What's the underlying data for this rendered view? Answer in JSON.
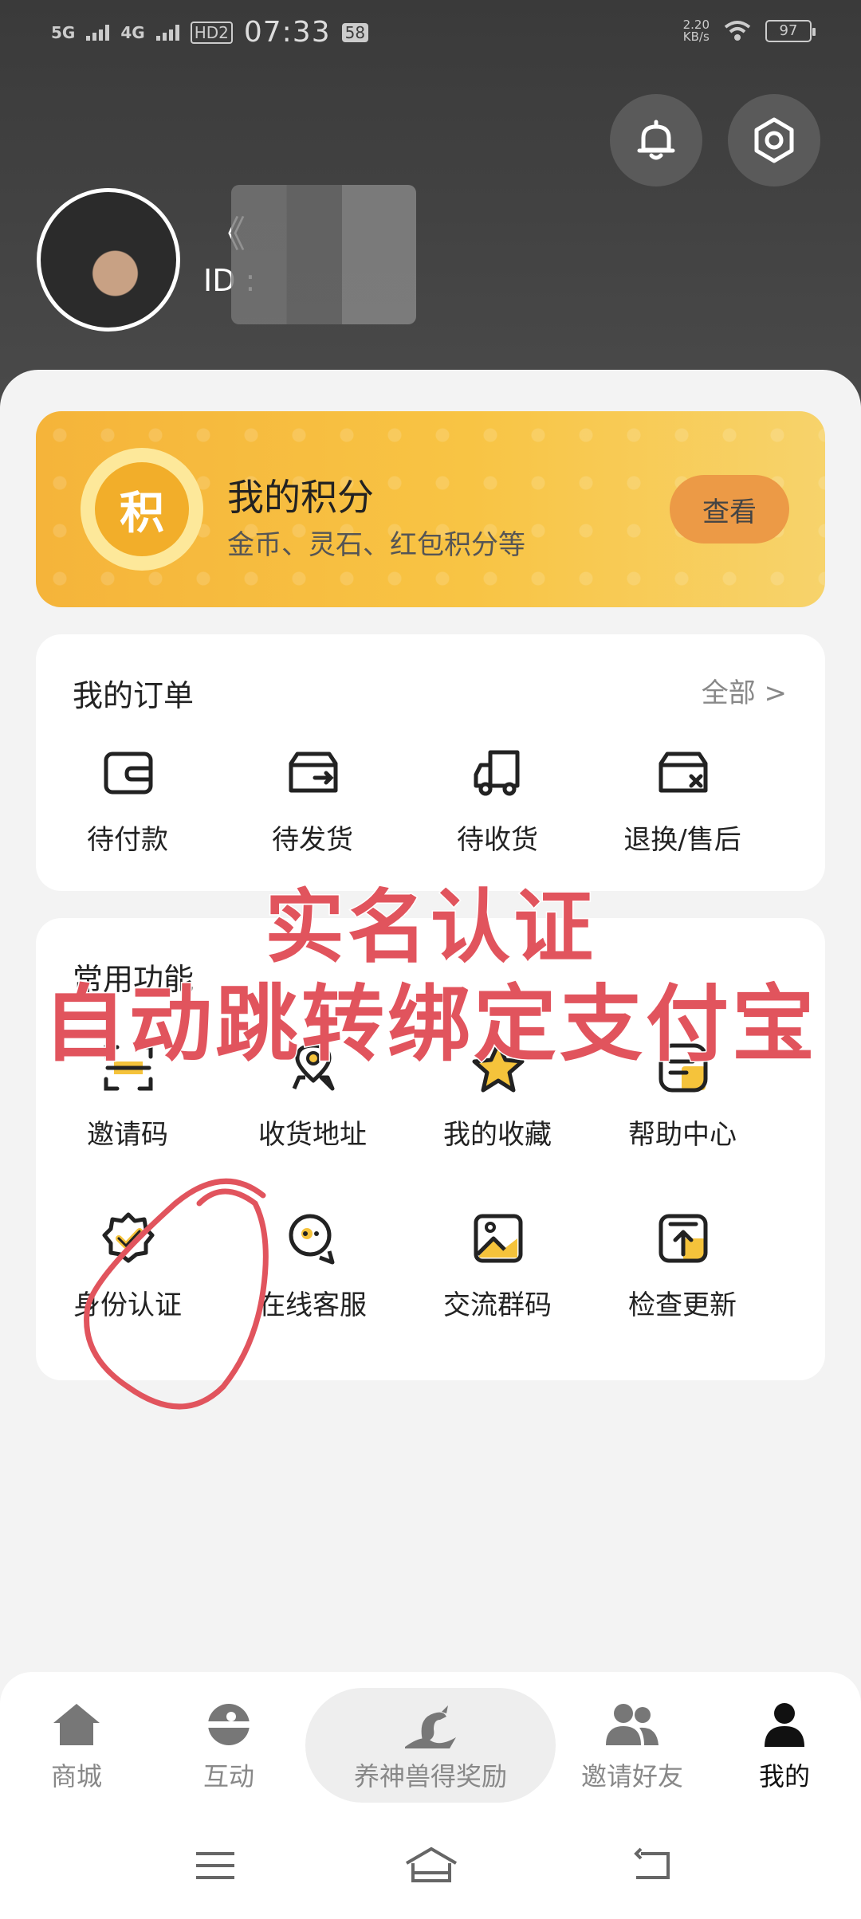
{
  "status": {
    "net1": "5G",
    "net2": "4G",
    "hd": "HD2",
    "time": "07:33",
    "badge": "58",
    "speed_value": "2.20",
    "speed_unit": "KB/s",
    "battery": "97"
  },
  "profile": {
    "name": "《",
    "id_label": "ID :"
  },
  "points_card": {
    "coin_char": "积",
    "title": "我的积分",
    "subtitle": "金币、灵石、红包积分等",
    "button": "查看"
  },
  "orders": {
    "title": "我的订单",
    "more": "全部 >",
    "items": [
      {
        "label": "待付款",
        "icon": "wallet-icon"
      },
      {
        "label": "待发货",
        "icon": "ship-box-icon"
      },
      {
        "label": "待收货",
        "icon": "truck-icon"
      },
      {
        "label": "退换/售后",
        "icon": "return-box-icon"
      }
    ]
  },
  "tools": {
    "title": "常用功能",
    "items": [
      {
        "label": "邀请码",
        "icon": "scan-code-icon"
      },
      {
        "label": "收货地址",
        "icon": "location-pin-icon"
      },
      {
        "label": "我的收藏",
        "icon": "star-icon"
      },
      {
        "label": "帮助中心",
        "icon": "help-doc-icon"
      },
      {
        "label": "身份认证",
        "icon": "verified-badge-icon"
      },
      {
        "label": "在线客服",
        "icon": "chat-service-icon"
      },
      {
        "label": "交流群码",
        "icon": "image-qr-icon"
      },
      {
        "label": "检查更新",
        "icon": "upload-update-icon"
      }
    ]
  },
  "annotation": {
    "line1": "实名认证",
    "line2": "自动跳转绑定支付宝"
  },
  "tabbar": {
    "items": [
      {
        "label": "商城",
        "icon": "home-icon"
      },
      {
        "label": "互动",
        "icon": "planet-icon"
      },
      {
        "label": "养神兽得奖励",
        "icon": "dragon-icon"
      },
      {
        "label": "邀请好友",
        "icon": "friends-icon"
      },
      {
        "label": "我的",
        "icon": "user-icon"
      }
    ],
    "active": "我的"
  },
  "colors": {
    "header_bg": "#3a3a3a",
    "points_gold": "#f8c444",
    "accent_yellow": "#f5c33b",
    "annotation_red": "#e1545d"
  }
}
